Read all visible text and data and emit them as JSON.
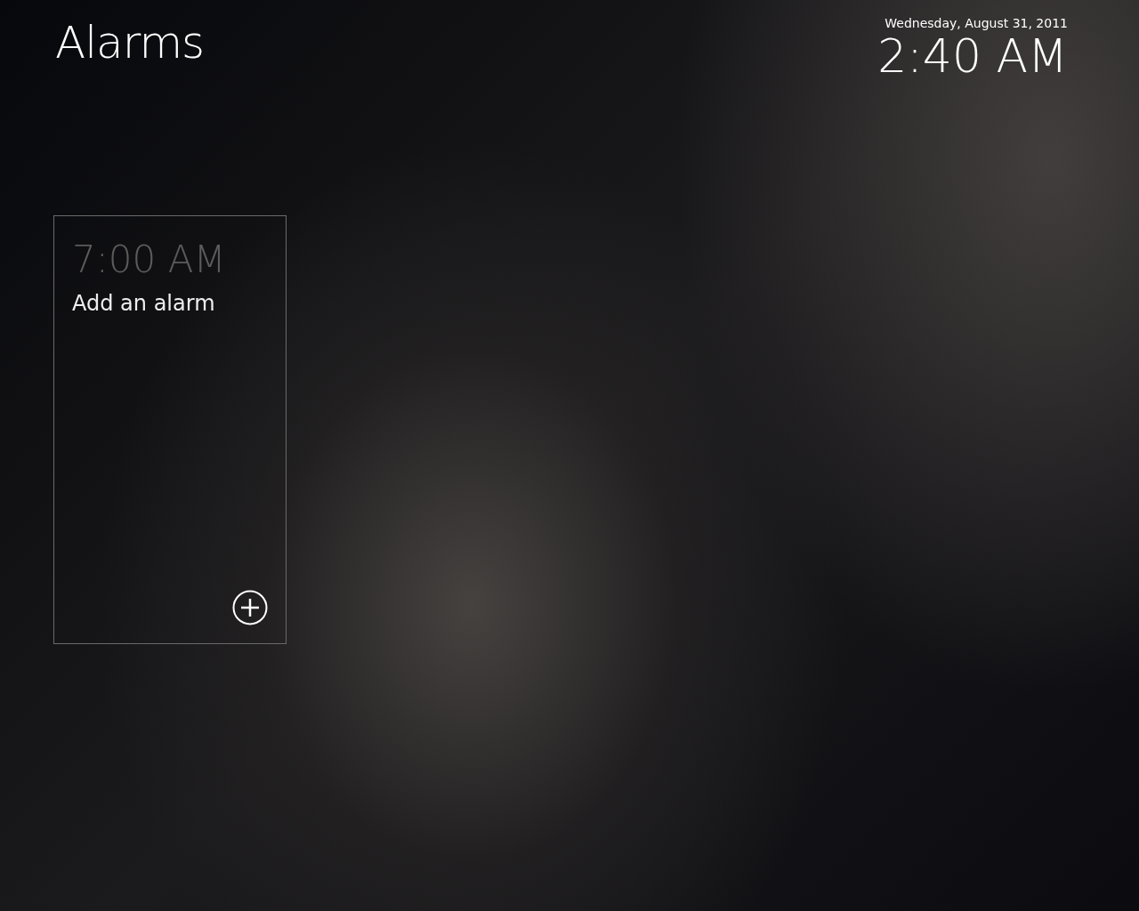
{
  "page": {
    "title": "Alarms"
  },
  "clock": {
    "date": "Wednesday, August 31, 2011",
    "time": "2:40 AM"
  },
  "tiles": [
    {
      "kind": "add",
      "time": "7:00 AM",
      "label": "Add an alarm"
    }
  ]
}
